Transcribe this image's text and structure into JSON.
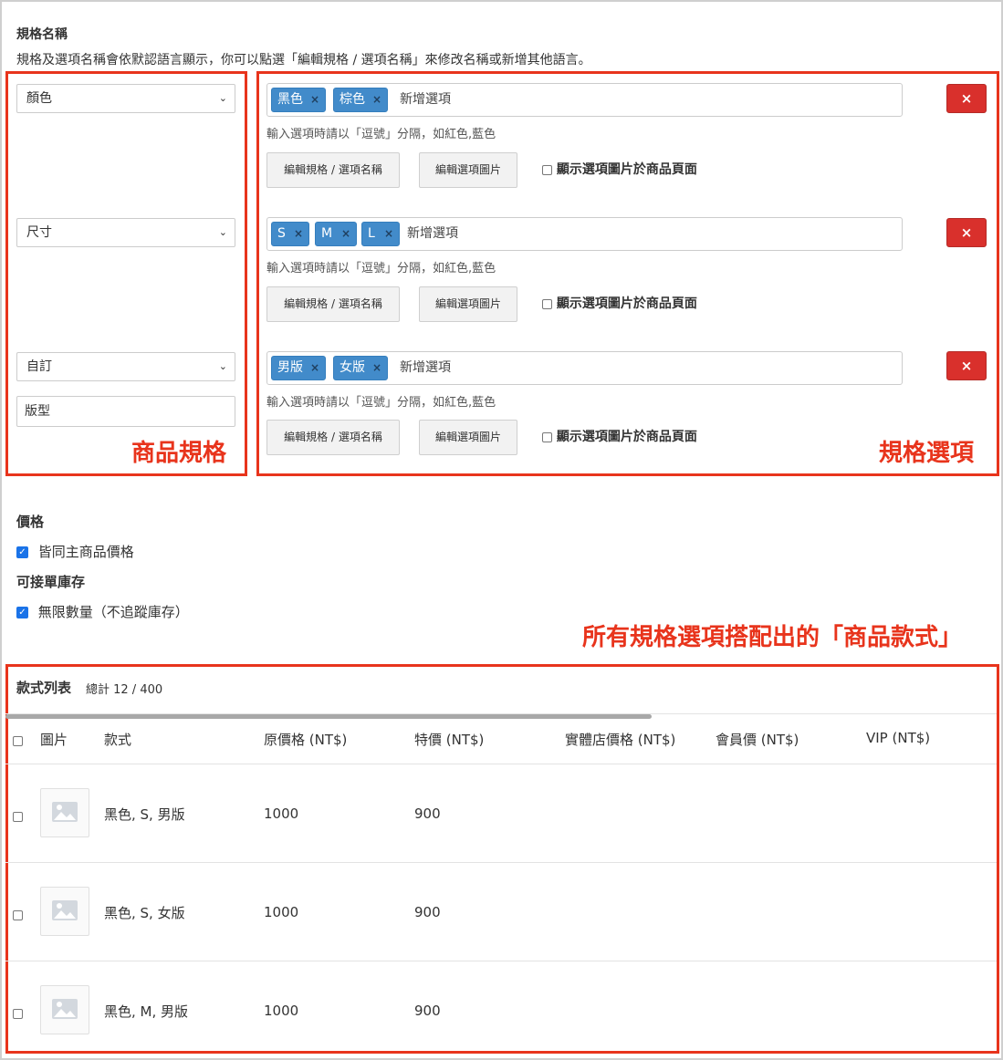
{
  "spec_section": {
    "title": "規格名稱",
    "description": "規格及選項名稱會依默認語言顯示，你可以點選「編輯規格 / 選項名稱」來修改名稱或新增其他語言。"
  },
  "specs": [
    {
      "select_value": "顏色",
      "tags": [
        "黑色",
        "棕色"
      ],
      "tag_placeholder": "新增選項",
      "hint": "輸入選項時請以「逗號」分隔，如紅色,藍色",
      "edit_names_button": "編輯規格 / 選項名稱",
      "edit_images_button": "編輯選項圖片",
      "show_images_label": "顯示選項圖片於商品頁面",
      "show_images_checked": false
    },
    {
      "select_value": "尺寸",
      "tags": [
        "S",
        "M",
        "L"
      ],
      "tag_placeholder": "新增選項",
      "hint": "輸入選項時請以「逗號」分隔，如紅色,藍色",
      "edit_names_button": "編輯規格 / 選項名稱",
      "edit_images_button": "編輯選項圖片",
      "show_images_label": "顯示選項圖片於商品頁面",
      "show_images_checked": false
    },
    {
      "select_value": "自訂",
      "custom_name": "版型",
      "tags": [
        "男版",
        "女版"
      ],
      "tag_placeholder": "新增選項",
      "hint": "輸入選項時請以「逗號」分隔，如紅色,藍色",
      "edit_names_button": "編輯規格 / 選項名稱",
      "edit_images_button": "編輯選項圖片",
      "show_images_label": "顯示選項圖片於商品頁面",
      "show_images_checked": false
    }
  ],
  "delete_icon": "×",
  "tag_remove_icon": "×",
  "annotations": {
    "spec_label": "商品規格",
    "options_label": "規格選項",
    "variants_label": "所有規格選項搭配出的「商品款式」",
    "color": "#e8341c"
  },
  "price": {
    "title": "價格",
    "same_price_label": "皆同主商品價格",
    "same_price_checked": true
  },
  "stock": {
    "title": "可接單庫存",
    "unlimited_label": "無限數量（不追蹤庫存）",
    "unlimited_checked": true
  },
  "variants": {
    "title": "款式列表",
    "count": "總計 12 / 400",
    "columns": [
      "圖片",
      "款式",
      "原價格 (NT$)",
      "特價 (NT$)",
      "實體店價格 (NT$)",
      "會員價 (NT$)",
      "VIP (NT$)"
    ],
    "rows": [
      {
        "name": "黑色, S, 男版",
        "price": "1000",
        "sale": "900"
      },
      {
        "name": "黑色, S, 女版",
        "price": "1000",
        "sale": "900"
      },
      {
        "name": "黑色, M, 男版",
        "price": "1000",
        "sale": "900"
      }
    ]
  },
  "colors": {
    "tag_blue": "#428bca",
    "delete_red": "#d9302c",
    "checkbox_blue": "#1a73e8"
  }
}
